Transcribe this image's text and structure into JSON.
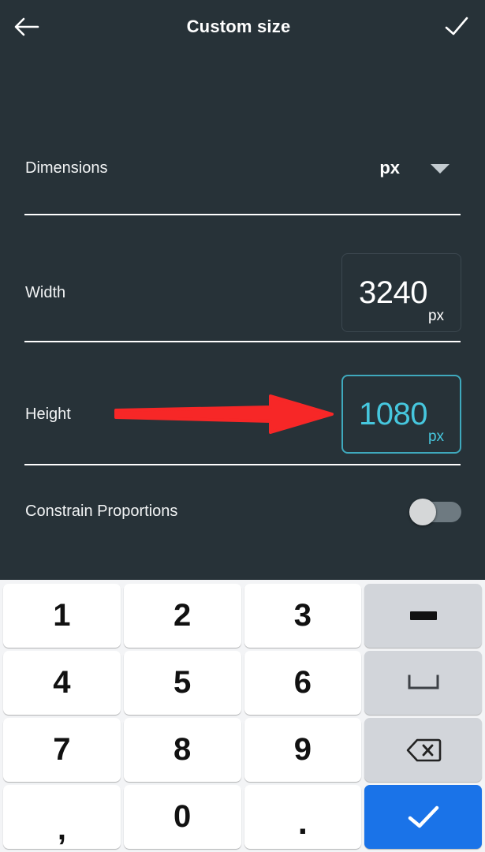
{
  "header": {
    "back_icon": "back-arrow-icon",
    "title": "Custom size",
    "done_icon": "check-icon"
  },
  "settings": {
    "dimensions": {
      "label": "Dimensions",
      "unit_value": "px",
      "dropdown_icon": "chevron-down-icon"
    },
    "width": {
      "label": "Width",
      "value": "3240",
      "unit": "px",
      "focused": false
    },
    "height": {
      "label": "Height",
      "value": "1080",
      "unit": "px",
      "focused": true
    },
    "constrain": {
      "label": "Constrain Proportions",
      "enabled": false
    }
  },
  "annotation": {
    "type": "red-arrow",
    "color": "#f72727",
    "points_to": "height-value-box"
  },
  "keyboard": {
    "rows": [
      [
        {
          "label": "1",
          "name": "key-1",
          "kind": "num"
        },
        {
          "label": "2",
          "name": "key-2",
          "kind": "num"
        },
        {
          "label": "3",
          "name": "key-3",
          "kind": "num"
        },
        {
          "label": "",
          "name": "key-minus",
          "kind": "fn",
          "icon": "minus-icon"
        }
      ],
      [
        {
          "label": "4",
          "name": "key-4",
          "kind": "num"
        },
        {
          "label": "5",
          "name": "key-5",
          "kind": "num"
        },
        {
          "label": "6",
          "name": "key-6",
          "kind": "num"
        },
        {
          "label": "",
          "name": "key-space",
          "kind": "fn",
          "icon": "space-icon"
        }
      ],
      [
        {
          "label": "7",
          "name": "key-7",
          "kind": "num"
        },
        {
          "label": "8",
          "name": "key-8",
          "kind": "num"
        },
        {
          "label": "9",
          "name": "key-9",
          "kind": "num"
        },
        {
          "label": "",
          "name": "key-backspace",
          "kind": "fn",
          "icon": "backspace-icon"
        }
      ],
      [
        {
          "label": ",",
          "name": "key-comma",
          "kind": "num"
        },
        {
          "label": "0",
          "name": "key-0",
          "kind": "num"
        },
        {
          "label": ".",
          "name": "key-period",
          "kind": "num"
        },
        {
          "label": "",
          "name": "key-enter",
          "kind": "ok",
          "icon": "check-icon"
        }
      ]
    ]
  },
  "colors": {
    "background": "#273238",
    "accent": "#46c7de",
    "annotation_red": "#f72727",
    "enter_blue": "#1a73e8",
    "keyboard_bg": "#f3f4f6"
  }
}
